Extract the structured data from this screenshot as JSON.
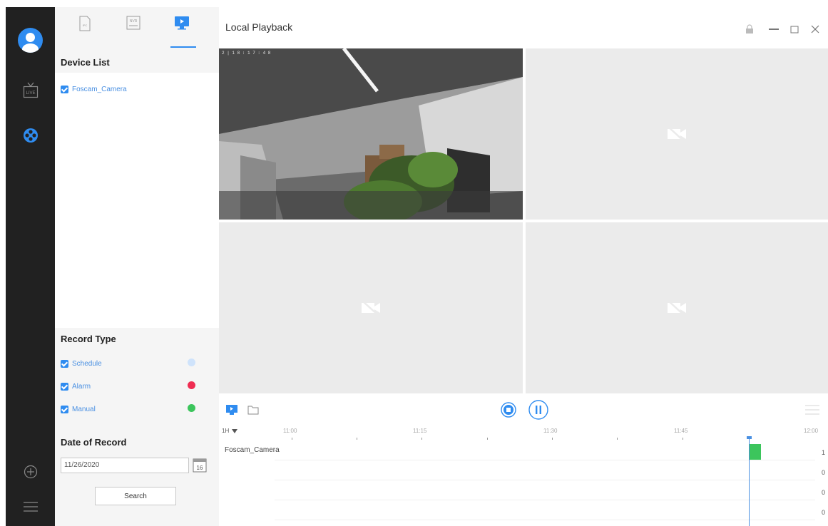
{
  "rail": {
    "live_label": "LIVE"
  },
  "panel": {
    "tabs": [
      {
        "name": "ipc",
        "label": "IPC"
      },
      {
        "name": "nvr",
        "label": "NVR"
      },
      {
        "name": "local",
        "label": "Local"
      }
    ],
    "device_list_title": "Device List",
    "devices": [
      {
        "label": "Foscam_Camera",
        "checked": true
      }
    ],
    "record_type_title": "Record Type",
    "record_types": [
      {
        "label": "Schedule",
        "checked": true,
        "color": "#cfe3fb"
      },
      {
        "label": "Alarm",
        "checked": true,
        "color": "#ef2d52"
      },
      {
        "label": "Manual",
        "checked": true,
        "color": "#3cc55c"
      }
    ],
    "date_title": "Date of Record",
    "date_value": "11/26/2020",
    "calendar_day": "16",
    "search_label": "Search"
  },
  "title_bar": {
    "title": "Local Playback"
  },
  "video": {
    "tile1_overlay": "2 | 1 8 : 1 7 : 4 8"
  },
  "timeline": {
    "scale": "1H",
    "ticks": [
      "11:00",
      "11:15",
      "11:30",
      "11:45",
      "12:00"
    ],
    "camera_label": "Foscam_Camera",
    "counts": [
      "1",
      "0",
      "0",
      "0"
    ]
  },
  "colors": {
    "accent": "#2f8cf0",
    "rail_bg": "#212121",
    "panel_bg": "#f5f5f5",
    "record_block": "#3cc55c"
  }
}
